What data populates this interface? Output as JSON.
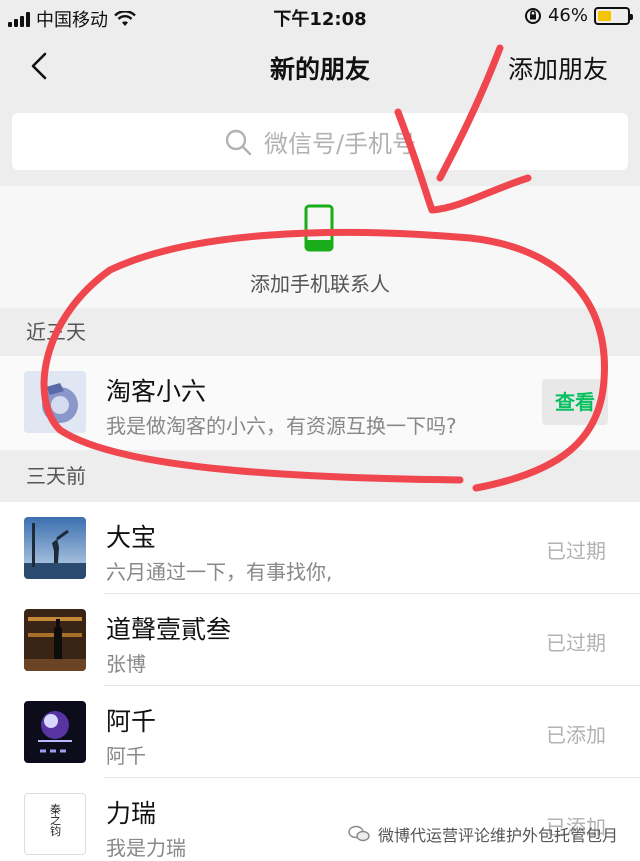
{
  "status_bar": {
    "carrier": "中国移动",
    "time": "下午12:08",
    "battery": "46%",
    "battery_level": 0.46,
    "icons": [
      "signal-icon",
      "wifi-icon",
      "rotation-lock-icon",
      "battery-icon"
    ]
  },
  "nav": {
    "title": "新的朋友",
    "action": "添加朋友",
    "back_icon": "chevron-left-icon"
  },
  "search": {
    "placeholder": "微信号/手机号"
  },
  "phone_contacts": {
    "label": "添加手机联系人"
  },
  "sections": {
    "recent": {
      "header": "近三天",
      "items": [
        {
          "name": "淘客小六",
          "message": "我是做淘客的小六，有资源互换一下吗?",
          "action": "查看"
        }
      ]
    },
    "older": {
      "header": "三天前",
      "items": [
        {
          "name": "大宝",
          "message": "六月通过一下，有事找你,",
          "status": "已过期"
        },
        {
          "name": "道聲壹貳叁",
          "message": "张博",
          "status": "已过期"
        },
        {
          "name": "阿千",
          "message": "阿千",
          "status": "已添加"
        },
        {
          "name": "力瑞",
          "message": "我是力瑞",
          "status": "已添加"
        }
      ]
    }
  },
  "avatar_text": {
    "lirui": "秦之钧"
  },
  "watermark": {
    "text": "微博代运营评论维护外包托管包月"
  },
  "colors": {
    "accent_green": "#07c160",
    "phone_icon_green": "#1aad19",
    "annotation_red": "#f0464e"
  }
}
